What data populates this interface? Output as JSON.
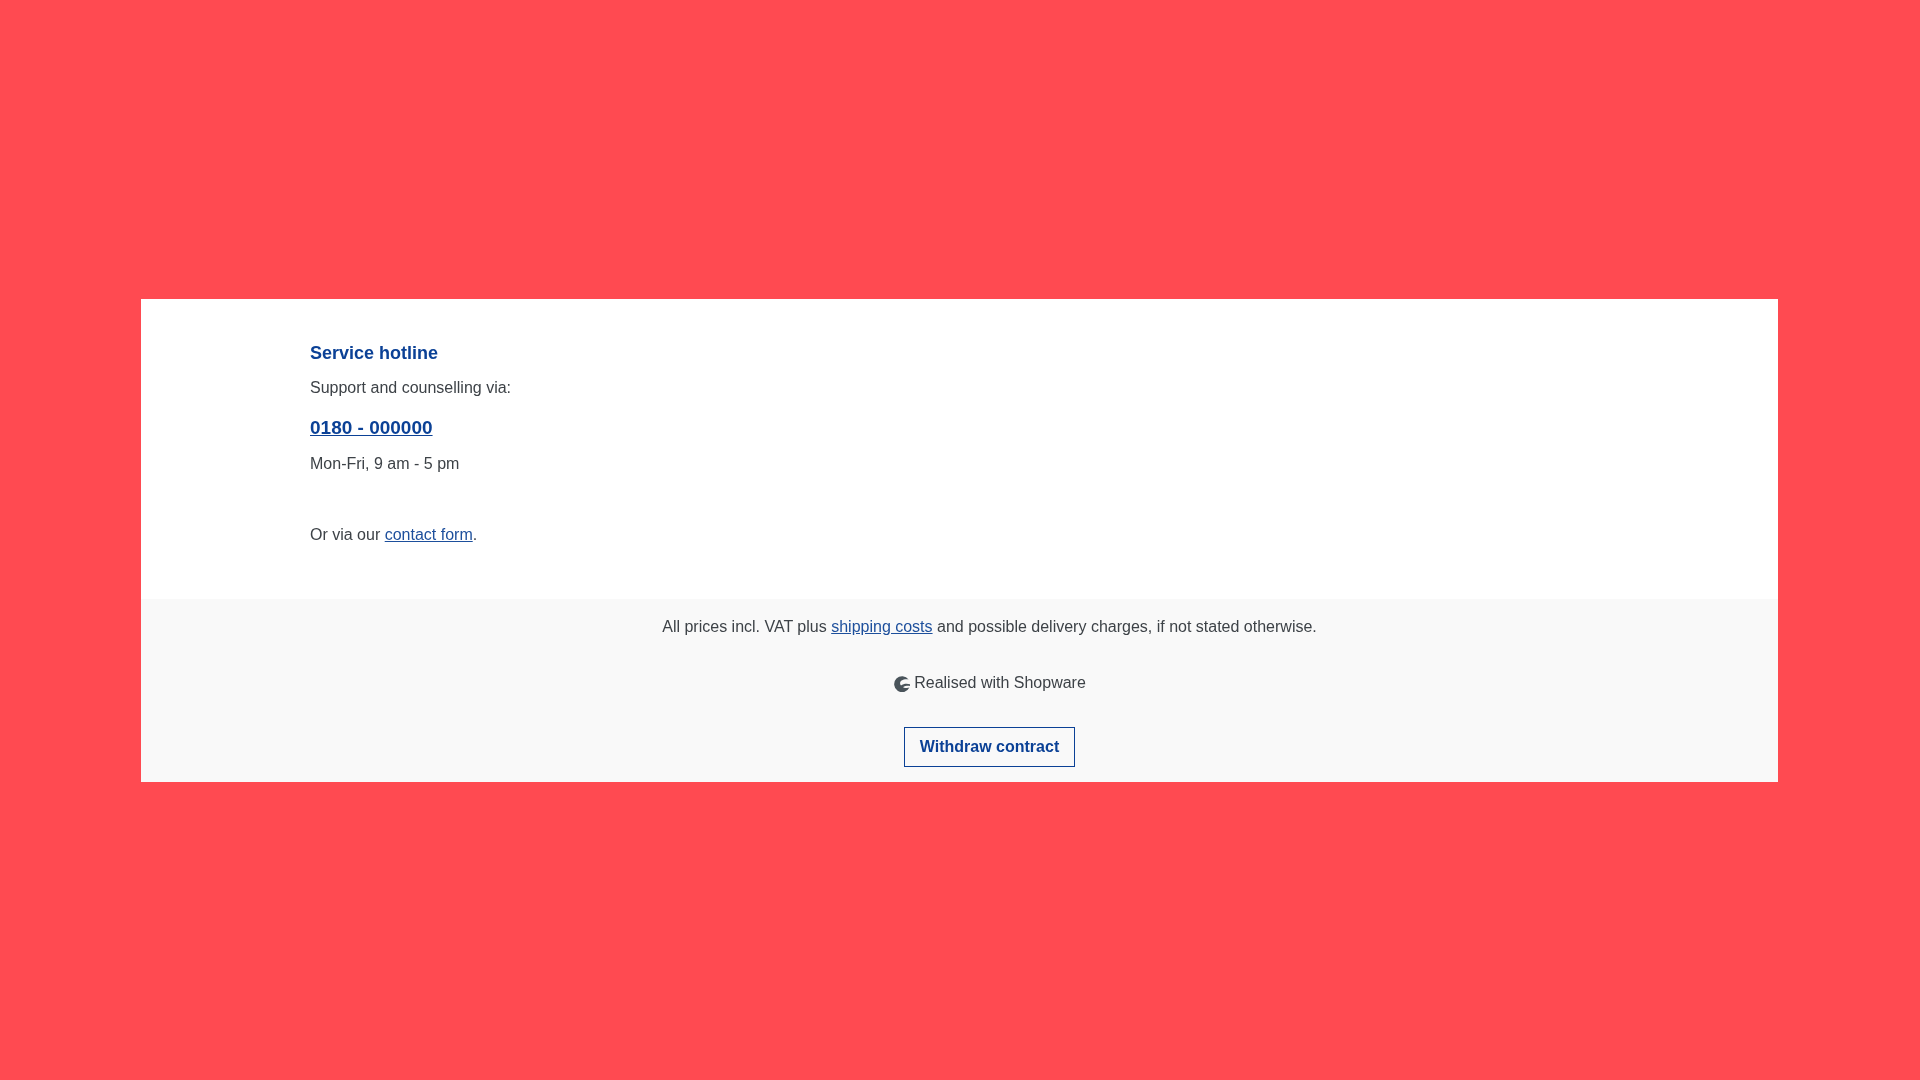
{
  "hotline": {
    "title": "Service hotline",
    "intro": "Support and counselling via:",
    "phone": "0180 - 000000",
    "hours": "Mon-Fri, 9 am - 5 pm",
    "contact_note": {
      "before": "Or via our ",
      "link": "contact form",
      "after": "."
    }
  },
  "footer": {
    "vat_notice": {
      "before": "All prices incl. VAT plus ",
      "link": "shipping costs",
      "after": " and possible delivery charges, if not stated otherwise."
    },
    "credit": "Realised with Shopware",
    "button": "Withdraw contract"
  }
}
